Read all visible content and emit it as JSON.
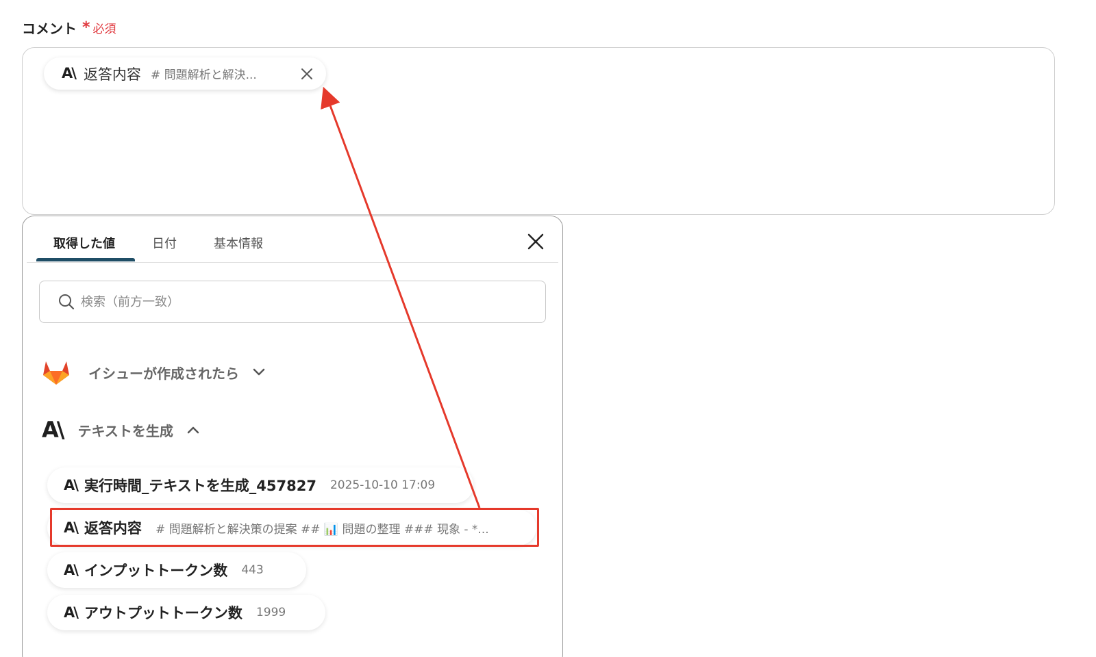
{
  "field": {
    "label": "コメント",
    "required_star": "*",
    "required_text": "必須"
  },
  "chip": {
    "logo": "A\\",
    "title": "返答内容",
    "preview": "# 問題解析と解決...",
    "close_icon": "close-icon"
  },
  "panel": {
    "tabs": [
      {
        "label": "取得した値",
        "active": true
      },
      {
        "label": "日付",
        "active": false
      },
      {
        "label": "基本情報",
        "active": false
      }
    ],
    "search": {
      "placeholder": "検索（前方一致）",
      "value": ""
    },
    "groups": [
      {
        "title": "イシューが作成されたら",
        "icon": "gitlab-fox-icon",
        "expanded": false
      },
      {
        "title": "テキストを生成",
        "icon": "anthropic-logo-icon",
        "expanded": true
      }
    ],
    "items": [
      {
        "logo": "A\\",
        "title": "実行時間_テキストを生成_457827",
        "value": "2025-10-10 17:09"
      },
      {
        "logo": "A\\",
        "title": "返答内容",
        "value": "# 問題解析と解決策の提案 ## 📊 問題の整理 ### 現象 - *..."
      },
      {
        "logo": "A\\",
        "title": "インプットトークン数",
        "value": "443"
      },
      {
        "logo": "A\\",
        "title": "アウトプットトークン数",
        "value": "1999"
      }
    ]
  },
  "colors": {
    "required": "#e0383e",
    "tab_underline": "#1f4e66",
    "annotation": "#e5392b"
  }
}
